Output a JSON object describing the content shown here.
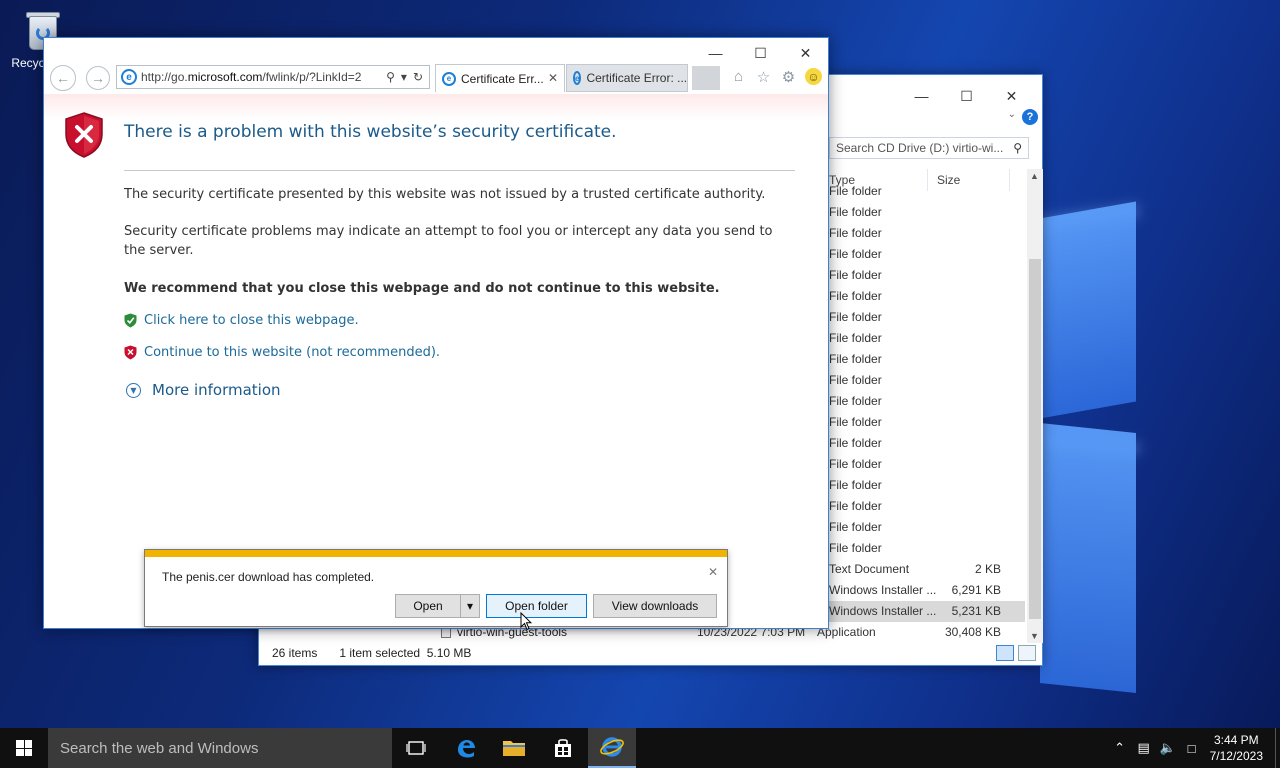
{
  "desktop": {
    "recycle_bin_label": "Recycle Bin"
  },
  "explorer": {
    "search_placeholder": "Search CD Drive (D:) virtio-wi...",
    "columns": {
      "type": "Type",
      "size": "Size"
    },
    "rows": [
      {
        "type": "File folder",
        "size": ""
      },
      {
        "type": "File folder",
        "size": ""
      },
      {
        "type": "File folder",
        "size": ""
      },
      {
        "type": "File folder",
        "size": ""
      },
      {
        "type": "File folder",
        "size": ""
      },
      {
        "type": "File folder",
        "size": ""
      },
      {
        "type": "File folder",
        "size": ""
      },
      {
        "type": "File folder",
        "size": ""
      },
      {
        "type": "File folder",
        "size": ""
      },
      {
        "type": "File folder",
        "size": ""
      },
      {
        "type": "File folder",
        "size": ""
      },
      {
        "type": "File folder",
        "size": ""
      },
      {
        "type": "File folder",
        "size": ""
      },
      {
        "type": "File folder",
        "size": ""
      },
      {
        "type": "File folder",
        "size": ""
      },
      {
        "type": "File folder",
        "size": ""
      },
      {
        "type": "File folder",
        "size": ""
      },
      {
        "type": "File folder",
        "size": ""
      },
      {
        "type": "Text Document",
        "size": "2 KB"
      },
      {
        "type": "Windows Installer ...",
        "size": "6,291 KB"
      },
      {
        "type": "Windows Installer ...",
        "size": "5,231 KB",
        "selected": true
      },
      {
        "name": "virtio-win-guest-tools",
        "date": "10/23/2022 7:03 PM",
        "type": "Application",
        "size": "30,408 KB"
      }
    ],
    "status": {
      "items": "26 items",
      "selected": "1 item selected  5.10 MB"
    }
  },
  "ie": {
    "address": {
      "prefix": "http://go.",
      "domain": "microsoft.com",
      "suffix": "/fwlink/p/?LinkId=2"
    },
    "tabs": [
      {
        "label": "Certificate Err...",
        "active": true
      },
      {
        "label": "Certificate Error: ...",
        "active": false
      }
    ],
    "page": {
      "heading": "There is a problem with this website’s security certificate.",
      "p1": "The security certificate presented by this website was not issued by a trusted certificate authority.",
      "p2": "Security certificate problems may indicate an attempt to fool you or intercept any data you send to the server.",
      "recommend": "We recommend that you close this webpage and do not continue to this website.",
      "close_link": "Click here to close this webpage.",
      "continue_link": "Continue to this website (not recommended).",
      "more_info": "More information"
    },
    "download_bar": {
      "message": "The penis.cer download has completed.",
      "open": "Open",
      "open_folder": "Open folder",
      "view_downloads": "View downloads"
    }
  },
  "taskbar": {
    "search_placeholder": "Search the web and Windows",
    "time": "3:44 PM",
    "date": "7/12/2023"
  },
  "colors": {
    "accent": "#0078d7",
    "link": "#1b6a99",
    "warning_bar": "#f0b400",
    "shield_red": "#c8102e"
  }
}
